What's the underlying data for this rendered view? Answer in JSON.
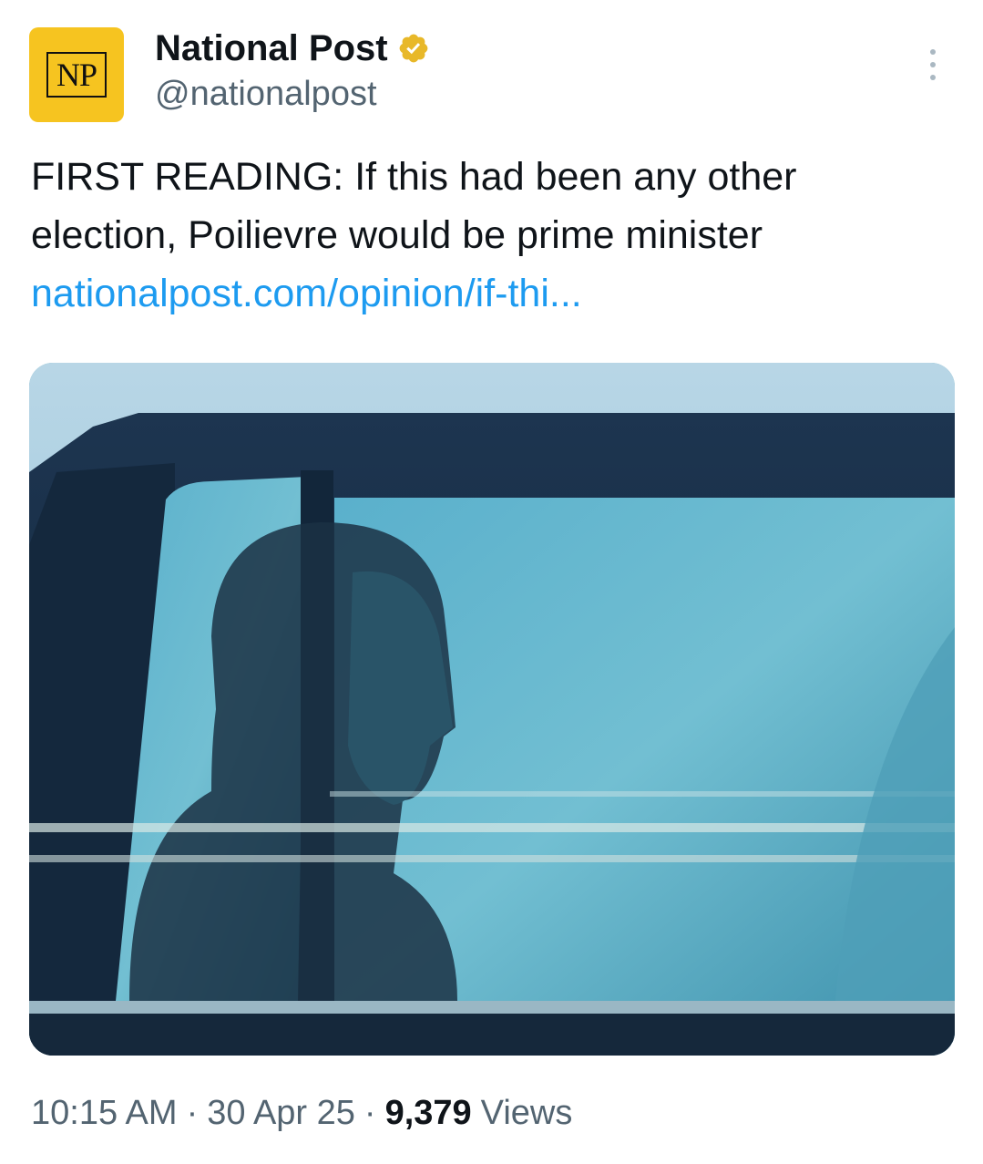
{
  "account": {
    "display_name": "National Post",
    "handle": "@nationalpost",
    "avatar_text": "NP",
    "verified_badge": "gold-verified-icon"
  },
  "tweet": {
    "text": "FIRST READING: If this had been any other election, Poilievre would be prime minister",
    "link": "nationalpost.com/opinion/if-thi..."
  },
  "meta": {
    "time": "10:15 AM",
    "date": "30 Apr 25",
    "separator": "·",
    "views_count": "9,379",
    "views_label": "Views"
  },
  "colors": {
    "link": "#1d9bf0",
    "secondary_text": "#536471",
    "avatar_bg": "#f6c420",
    "verified_gold": "#e8b829"
  }
}
